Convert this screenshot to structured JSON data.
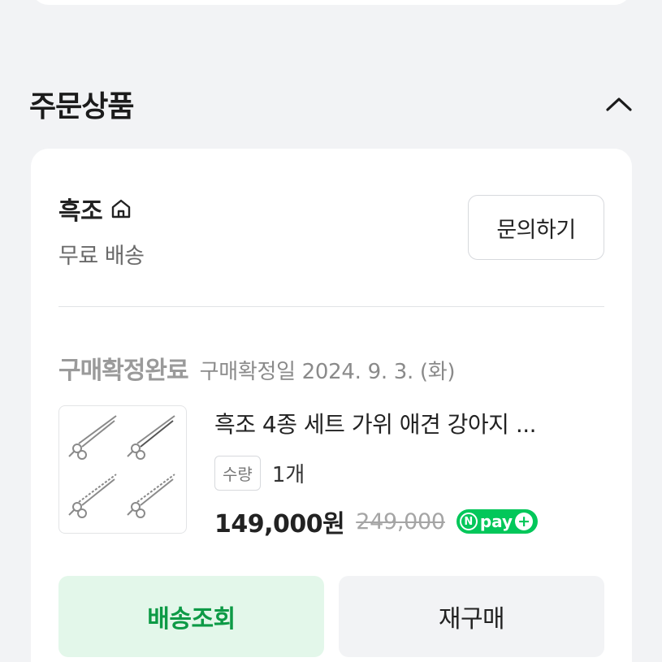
{
  "section": {
    "title": "주문상품"
  },
  "seller": {
    "name": "흑조",
    "shipping": "무료 배송",
    "inquiry_label": "문의하기"
  },
  "order": {
    "status": "구매확정완료",
    "confirm_date": "구매확정일 2024. 9. 3. (화)"
  },
  "product": {
    "name": "흑조 4종 세트 가위 애견 강아지 ...",
    "qty_label": "수량",
    "qty_value": "1개",
    "price": "149,000원",
    "original_price": "249,000",
    "pay_badge": "pay"
  },
  "actions": {
    "track_label": "배송조회",
    "rebuy_label": "재구매"
  },
  "colors": {
    "accent_green": "#03c75a",
    "track_text": "#0d9a46",
    "track_bg": "#e3f7ea"
  },
  "icons": {
    "collapse": "chevron-up-icon",
    "store": "home-icon"
  }
}
